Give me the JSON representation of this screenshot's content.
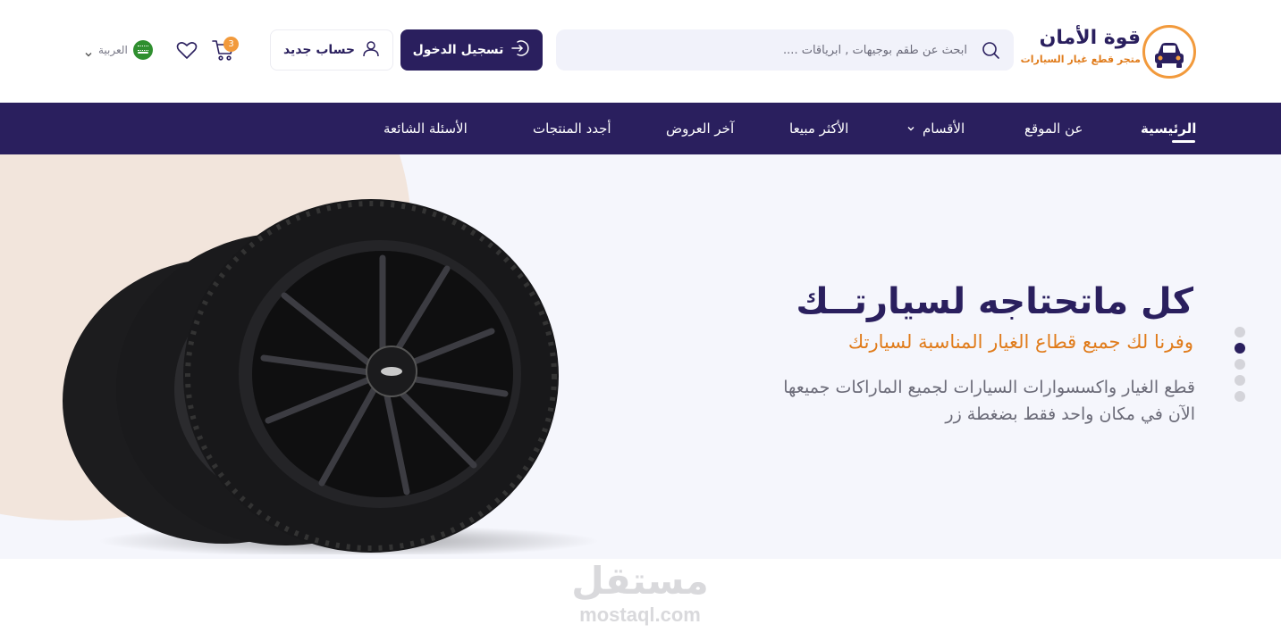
{
  "header": {
    "logo": {
      "name": "قوة الأمان",
      "tagline": "متجر قطع غيار السيارات"
    },
    "search": {
      "placeholder": "ابحث عن طقم بوجيهات , ابرياقات ....",
      "icon": "search-icon"
    },
    "login_label": "تسجيل الدخول",
    "register_label": "حساب جديد",
    "cart_count": "3",
    "language_label": "العربية"
  },
  "nav": {
    "items": [
      {
        "label": "الرئيسية",
        "active": true
      },
      {
        "label": "عن الموقع"
      },
      {
        "label": "الأقسام",
        "has_dropdown": true
      },
      {
        "label": "الأكثر مبيعا"
      },
      {
        "label": "آخر العروض"
      },
      {
        "label": "أجدد المنتجات"
      },
      {
        "label": "الأسئلة الشائعة"
      }
    ]
  },
  "hero": {
    "title": "كل ماتحتاجه لسيارتــك",
    "subtitle": "وفرنا لك جميع قطاع الغيار المناسبة لسيارتك",
    "description": "قطع الغيار واكسسوارات السيارات لجميع الماراكات جميعها الآن في مكان واحد فقط بضغطة زر",
    "slides_total": 5,
    "active_slide": 2
  },
  "watermark": {
    "arabic": "مستقل",
    "latin": "mostaql.com"
  },
  "colors": {
    "primary": "#2a1f5e",
    "accent": "#e07b1a",
    "badge": "#f29a3c",
    "hero_bg": "#f5f6fc",
    "blob": "#f2e5dc"
  }
}
